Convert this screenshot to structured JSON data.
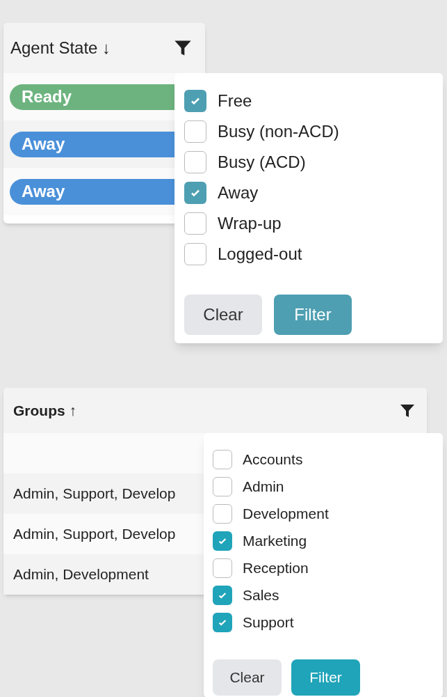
{
  "panels": [
    {
      "kind": "badges",
      "header": {
        "title": "Agent State",
        "sort": "↓"
      },
      "rows": [
        {
          "text": "Ready",
          "color": "#6db37f"
        },
        {
          "text": "Away",
          "color": "#4a90d9"
        },
        {
          "text": "Away",
          "color": "#4a90d9"
        }
      ],
      "filter_menu": {
        "options": [
          {
            "label": "Free",
            "checked": true
          },
          {
            "label": "Busy (non-ACD)",
            "checked": false
          },
          {
            "label": "Busy (ACD)",
            "checked": false
          },
          {
            "label": "Away",
            "checked": true
          },
          {
            "label": "Wrap-up",
            "checked": false
          },
          {
            "label": "Logged-out",
            "checked": false
          }
        ],
        "buttons": [
          "Clear",
          "Filter"
        ]
      }
    },
    {
      "kind": "text",
      "header": {
        "title": "Groups",
        "sort": "↑"
      },
      "rows": [
        {
          "text": "Admin, Support, Develop"
        },
        {
          "text": "Admin, Support, Develop"
        },
        {
          "text": "Admin, Development"
        }
      ],
      "filter_menu": {
        "options": [
          {
            "label": "Accounts",
            "checked": false
          },
          {
            "label": "Admin",
            "checked": false
          },
          {
            "label": "Development",
            "checked": false
          },
          {
            "label": "Marketing",
            "checked": true
          },
          {
            "label": "Reception",
            "checked": false
          },
          {
            "label": "Sales",
            "checked": true
          },
          {
            "label": "Support",
            "checked": true
          }
        ],
        "buttons": [
          "Clear",
          "Filter"
        ]
      }
    }
  ]
}
